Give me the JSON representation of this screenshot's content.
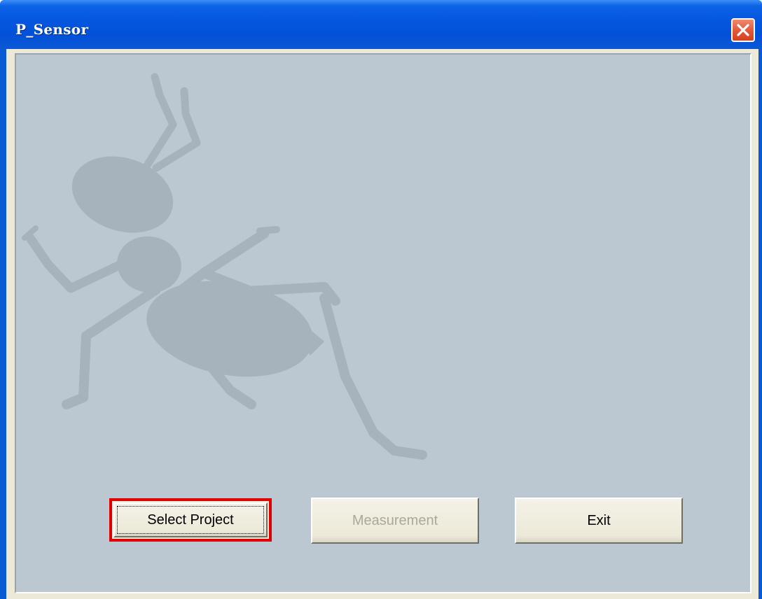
{
  "window": {
    "title": "P_Sensor",
    "close_icon": "close-icon"
  },
  "colors": {
    "titlebar": "#0556df",
    "panel_background": "#bcc8d1",
    "ant_watermark": "#a6b3bc",
    "highlight_border": "#e00000",
    "disabled_text": "#aca899"
  },
  "watermark": {
    "icon": "ant-icon"
  },
  "buttons": {
    "select_project": "Select Project",
    "measurement": "Measurement",
    "exit": "Exit"
  }
}
